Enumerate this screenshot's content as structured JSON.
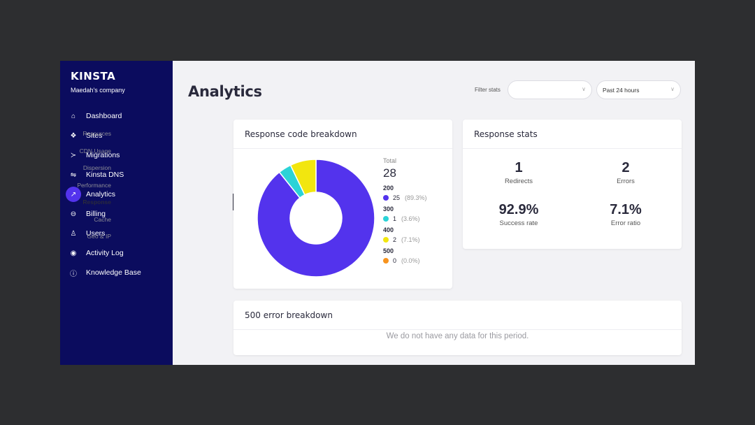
{
  "sidebar": {
    "logo": "KINSTA",
    "company": "Maedah's company",
    "items": [
      {
        "label": "Dashboard",
        "icon": "⌂"
      },
      {
        "label": "Sites",
        "icon": "❖"
      },
      {
        "label": "Migrations",
        "icon": "≻"
      },
      {
        "label": "Kinsta DNS",
        "icon": "⇋"
      },
      {
        "label": "Analytics",
        "icon": "↗"
      },
      {
        "label": "Billing",
        "icon": "⊖"
      },
      {
        "label": "Users",
        "icon": "♙"
      },
      {
        "label": "Activity Log",
        "icon": "◉"
      },
      {
        "label": "Knowledge Base",
        "icon": "ⓘ"
      }
    ],
    "active": "Analytics"
  },
  "header": {
    "title": "Analytics",
    "filter_label": "Filter stats",
    "filter_value": "",
    "period_value": "Past 24 hours"
  },
  "subnav": {
    "items": [
      "Resources",
      "CDN Usage",
      "Dispersion",
      "Performance",
      "Response",
      "Cache",
      "Geo & IP"
    ],
    "active": "Response"
  },
  "response_code_card": {
    "title": "Response code breakdown",
    "total_label": "Total",
    "total": "28",
    "codes": [
      {
        "code": "200",
        "count": "25",
        "pct": "(89.3%)",
        "color": "#5333ed"
      },
      {
        "code": "300",
        "count": "1",
        "pct": "(3.6%)",
        "color": "#2bd3d7"
      },
      {
        "code": "400",
        "count": "2",
        "pct": "(7.1%)",
        "color": "#f2e60f"
      },
      {
        "code": "500",
        "count": "0",
        "pct": "(0.0%)",
        "color": "#f7931e"
      }
    ]
  },
  "chart_data": {
    "type": "pie",
    "title": "Response code breakdown",
    "categories": [
      "200",
      "300",
      "400",
      "500"
    ],
    "values": [
      25,
      1,
      2,
      0
    ],
    "colors": [
      "#5333ed",
      "#2bd3d7",
      "#f2e60f",
      "#f7931e"
    ],
    "donut": true
  },
  "response_stats": {
    "title": "Response stats",
    "stats": [
      {
        "value": "1",
        "label": "Redirects"
      },
      {
        "value": "2",
        "label": "Errors"
      },
      {
        "value": "92.9%",
        "label": "Success rate"
      },
      {
        "value": "7.1%",
        "label": "Error ratio"
      }
    ]
  },
  "error_500": {
    "title": "500 error breakdown",
    "empty_text": "We do not have any data for this period."
  }
}
